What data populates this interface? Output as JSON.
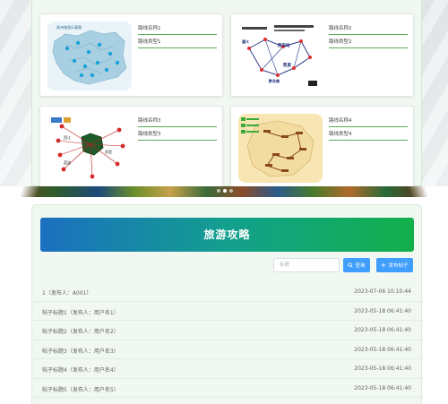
{
  "routes": [
    {
      "name": "路线名称1",
      "category": "路线类型1",
      "map": "map-1"
    },
    {
      "name": "路线名称2",
      "category": "路线类型2",
      "map": "map-2"
    },
    {
      "name": "路线名称3",
      "category": "路线类型3",
      "map": "map-3"
    },
    {
      "name": "路线名称4",
      "category": "路线类型4",
      "map": "map-4"
    }
  ],
  "map_labels": {
    "m1_title": "贵州旅游示意图",
    "m2_a": "遵义",
    "m2_b": "黄果树",
    "m2_c": "西安站",
    "m2_d": "凯里",
    "m2_e": "荔波",
    "m2_f": "镇远",
    "m2_g": "黔东南",
    "m3_a": "黄果树",
    "m3_b": "西江",
    "m3_c": "梵净山",
    "m3_d": "荔波",
    "m3_e": "凯里",
    "m3_f": "遵义",
    "m4_a": "成都",
    "m4_b": "贵阳",
    "m4_c": "凯里",
    "m4_d": "荔波",
    "m4_e": "黄果树"
  },
  "banner": {
    "dot_count": 3,
    "active": 1
  },
  "guide": {
    "title": "旅游攻略",
    "search_placeholder": "标题",
    "query_label": "查询",
    "post_label": "发布帖子",
    "posts": [
      {
        "title": "1（发布人：A001）",
        "time": "2023-07-06 10:10:44"
      },
      {
        "title": "帖子标题1（发布人：用户名1）",
        "time": "2023-05-18 06:41:40"
      },
      {
        "title": "帖子标题2（发布人：用户名2）",
        "time": "2023-05-18 06:41:40"
      },
      {
        "title": "帖子标题3（发布人：用户名3）",
        "time": "2023-05-18 06:41:40"
      },
      {
        "title": "帖子标题4（发布人：用户名4）",
        "time": "2023-05-18 06:41:40"
      },
      {
        "title": "帖子标题5（发布人：用户名5）",
        "time": "2023-05-18 06:41:40"
      }
    ]
  },
  "colors": {
    "accent": "#409eff",
    "header_start": "#1b6fc0",
    "header_end": "#13b04a",
    "panel_bg": "#f1f8f1",
    "meta_line": "#5aa95a"
  }
}
